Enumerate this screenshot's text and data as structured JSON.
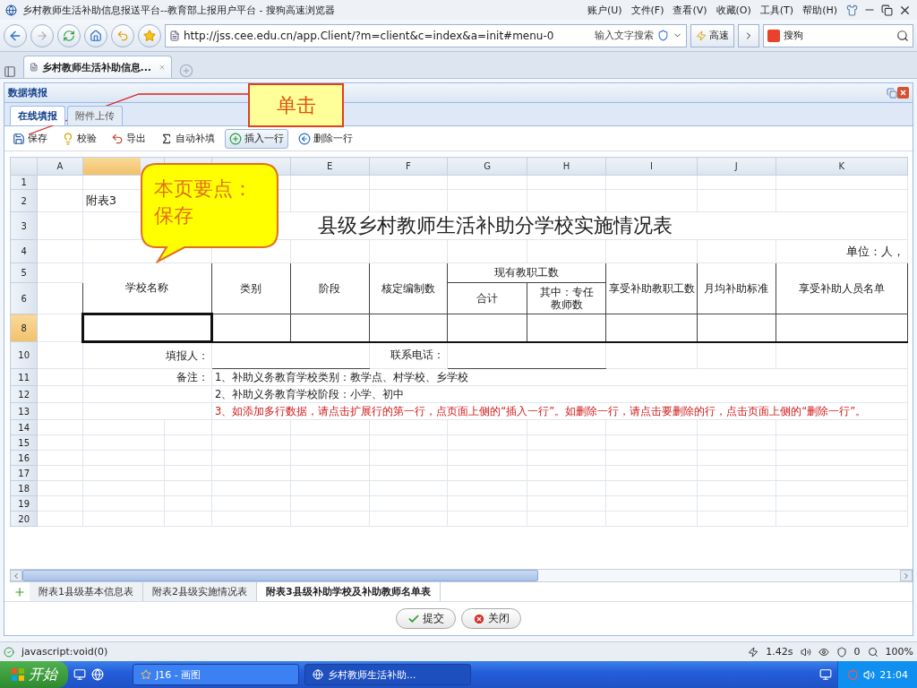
{
  "browser": {
    "title": "乡村教师生活补助信息报送平台--教育部上报用户平台 - 搜狗高速浏览器",
    "menu": [
      "账户(U)",
      "文件(F)",
      "查看(V)",
      "收藏(O)",
      "工具(T)",
      "帮助(H)"
    ],
    "address": "http://jss.cee.edu.cn/app.Client/?m=client&c=index&a=init#menu-0",
    "search_hint": "输入文字搜索",
    "speed": "高速",
    "engine": "搜狗",
    "tab": {
      "title": "乡村教师生活补助信息..."
    }
  },
  "note": {
    "text": "单击"
  },
  "callout": {
    "text": "本页要点：保存"
  },
  "panel": {
    "title": "数据填报",
    "tabs": [
      {
        "label": "在线填报",
        "selected": true
      },
      {
        "label": "附件上传",
        "selected": false
      }
    ],
    "toolbar": [
      {
        "label": "保存",
        "selected": false
      },
      {
        "label": "校验",
        "selected": false
      },
      {
        "label": "导出",
        "selected": false
      },
      {
        "label": "自动补填",
        "selected": false
      },
      {
        "label": "插入一行",
        "selected": true
      },
      {
        "label": "删除一行",
        "selected": false
      }
    ]
  },
  "sheet": {
    "columns": [
      {
        "label": "A",
        "selected": false
      },
      {
        "selected": true
      },
      {
        "label": "E",
        "selected": false
      },
      {
        "label": "F",
        "selected": false
      },
      {
        "label": "G",
        "selected": false
      },
      {
        "label": "H",
        "selected": false
      },
      {
        "label": "I",
        "selected": false
      },
      {
        "label": "J",
        "selected": false
      },
      {
        "label": "K",
        "selected": false
      }
    ],
    "row_numbers": [
      {
        "label": "1",
        "selected": false
      },
      {
        "label": "2",
        "selected": false
      },
      {
        "label": "3",
        "selected": false
      },
      {
        "label": "4",
        "selected": false
      },
      {
        "label": "5",
        "selected": false
      },
      {
        "label": "6",
        "selected": false
      },
      {
        "label": "8",
        "selected": true
      },
      {
        "label": "10",
        "selected": false
      },
      {
        "label": "11",
        "selected": false
      },
      {
        "label": "12",
        "selected": false
      },
      {
        "label": "13",
        "selected": false
      },
      {
        "label": "14",
        "selected": false
      },
      {
        "label": "15",
        "selected": false
      },
      {
        "label": "16",
        "selected": false
      },
      {
        "label": "17",
        "selected": false
      },
      {
        "label": "18",
        "selected": false
      },
      {
        "label": "19",
        "selected": false
      },
      {
        "label": "20",
        "selected": false
      }
    ],
    "caption": "附表3",
    "title": "县级乡村教师生活补助分学校实施情况表",
    "unit": "单位：人，",
    "headers": [
      "学校名称",
      "类别",
      "阶段",
      "核定编制数",
      "现有教职工数",
      "合计",
      "其中：专任教师数",
      "享受补助教职工数",
      "月均补助标准",
      "享受补助人员名单"
    ],
    "reporter_label": "填报人：",
    "phone_label": "联系电话：",
    "notes_label": "备注：",
    "notes": [
      {
        "text": "1、补助义务教育学校类别：教学点、村学校、乡学校",
        "kind": "normal"
      },
      {
        "text": "2、补助义务教育学校阶段：小学、初中",
        "kind": "normal"
      },
      {
        "text": "3、如添加多行数据，请点击扩展行的第一行，点页面上侧的“插入一行”。如删除一行，请点击要删除的行，点击页面上侧的“删除一行”。",
        "kind": "warning"
      }
    ]
  },
  "sheet_tabs": [
    {
      "label": "附表1县级基本信息表",
      "selected": false
    },
    {
      "label": "附表2县级实施情况表",
      "selected": false
    },
    {
      "label": "附表3县级补助学校及补助教师名单表",
      "selected": true
    }
  ],
  "buttons": [
    "提交",
    "关闭"
  ],
  "status": {
    "text": "javascript:void(0)",
    "time": "1.42s",
    "count": "0",
    "zoom": "100%"
  },
  "taskbar": {
    "start": "开始",
    "windows": [
      {
        "label": "J16 - 画图",
        "selected": false
      },
      {
        "label": "乡村教师生活补助...",
        "selected": true
      }
    ],
    "clock": "21:04"
  }
}
